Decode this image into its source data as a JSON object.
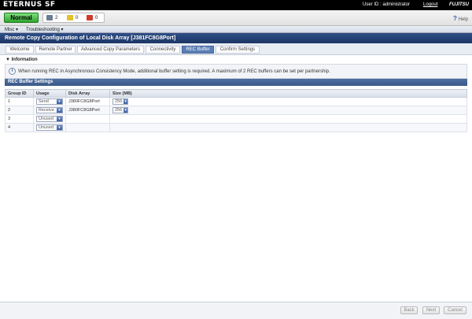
{
  "app": {
    "brand": "ETERNUS SF",
    "user_id": "User ID : administrator",
    "logout": "Logout",
    "vendor": "FUJITSU"
  },
  "status": {
    "normal_label": "Normal",
    "counts": [
      {
        "icon": "monitor-icon",
        "value": "2"
      },
      {
        "icon": "warning-icon",
        "value": "0"
      },
      {
        "icon": "error-icon",
        "value": "0"
      }
    ],
    "help_label": "Help"
  },
  "menu": {
    "items": [
      "Misc ▾",
      "Troubleshooting ▾"
    ]
  },
  "page": {
    "title": "Remote Copy Configuration of Local Disk Array [J381FC8G8Port]"
  },
  "wizard": {
    "steps": [
      "Welcome",
      "Remote Partner",
      "Advanced Copy Parameters",
      "Connectivity",
      "REC Buffer",
      "Confirm Settings"
    ],
    "active": "REC Buffer"
  },
  "information": {
    "header": "▼ Information",
    "text": "When running REC in Asynchronous Consistency Mode, additional buffer setting is required. A maximum of 2 REC buffers can be set per partnership."
  },
  "rec_buffer": {
    "header": "REC Buffer Settings",
    "columns": [
      "Group ID",
      "Usage",
      "Disk Array",
      "Size (MB)"
    ],
    "rows": [
      {
        "group_id": "1",
        "usage": "Send",
        "disk_array": "J380FC8G8Port",
        "size": "256"
      },
      {
        "group_id": "2",
        "usage": "Receive",
        "disk_array": "J380FC8G8Port",
        "size": "256"
      },
      {
        "group_id": "3",
        "usage": "Unused",
        "disk_array": "",
        "size": ""
      },
      {
        "group_id": "4",
        "usage": "Unused",
        "disk_array": "",
        "size": ""
      }
    ]
  },
  "footer": {
    "back": "Back",
    "next": "Next",
    "cancel": "Cancel"
  }
}
